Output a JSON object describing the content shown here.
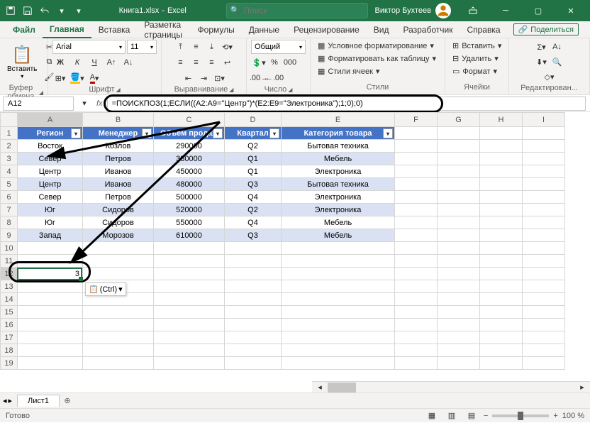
{
  "titlebar": {
    "doc": "Книга1.xlsx",
    "app": "Excel",
    "search_ph": "Поиск",
    "user": "Виктор Бухтеев"
  },
  "tabs": {
    "file": "Файл",
    "home": "Главная",
    "insert": "Вставка",
    "layout": "Разметка страницы",
    "formulas": "Формулы",
    "data": "Данные",
    "review": "Рецензирование",
    "view": "Вид",
    "dev": "Разработчик",
    "help": "Справка",
    "share": "Поделиться"
  },
  "ribbon": {
    "clipboard": {
      "paste": "Вставить",
      "label": "Буфер обмена"
    },
    "font": {
      "name": "Arial",
      "size": "11",
      "label": "Шрифт"
    },
    "align": {
      "label": "Выравнивание"
    },
    "number": {
      "format": "Общий",
      "label": "Число"
    },
    "styles": {
      "cond": "Условное форматирование",
      "table": "Форматировать как таблицу",
      "cell": "Стили ячеек",
      "label": "Стили"
    },
    "cells": {
      "insert": "Вставить",
      "delete": "Удалить",
      "format": "Формат",
      "label": "Ячейки"
    },
    "editing": {
      "label": "Редактирован..."
    }
  },
  "formula_bar": {
    "cell": "A12",
    "formula": "=ПОИСКПОЗ(1;ЕСЛИ((A2:A9=\"Центр\")*(E2:E9=\"Электроника\");1;0);0)"
  },
  "table": {
    "headers": [
      "Регион",
      "Менеджер",
      "Объем продаж",
      "Квартал",
      "Категория товара"
    ],
    "rows": [
      [
        "Восток",
        "Козлов",
        "290000",
        "Q2",
        "Бытовая техника"
      ],
      [
        "Север",
        "Петров",
        "380000",
        "Q1",
        "Мебель"
      ],
      [
        "Центр",
        "Иванов",
        "450000",
        "Q1",
        "Электроника"
      ],
      [
        "Центр",
        "Иванов",
        "480000",
        "Q3",
        "Бытовая техника"
      ],
      [
        "Север",
        "Петров",
        "500000",
        "Q4",
        "Электроника"
      ],
      [
        "Юг",
        "Сидоров",
        "520000",
        "Q2",
        "Электроника"
      ],
      [
        "Юг",
        "Сидоров",
        "550000",
        "Q4",
        "Мебель"
      ],
      [
        "Запад",
        "Морозов",
        "610000",
        "Q3",
        "Мебель"
      ]
    ],
    "result": "3",
    "paste_hint": "(Ctrl)"
  },
  "sheet": {
    "name": "Лист1"
  },
  "status": {
    "ready": "Готово",
    "zoom": "100 %"
  }
}
